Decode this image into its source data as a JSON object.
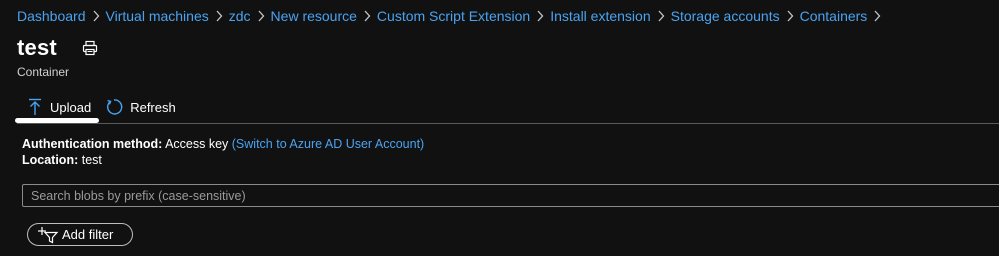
{
  "breadcrumb": {
    "items": [
      "Dashboard",
      "Virtual machines",
      "zdc",
      "New resource",
      "Custom Script Extension",
      "Install extension",
      "Storage accounts",
      "Containers"
    ]
  },
  "header": {
    "title": "test",
    "subtitle": "Container",
    "icons": [
      "print-icon"
    ]
  },
  "toolbar": {
    "upload_label": "Upload",
    "refresh_label": "Refresh",
    "icons": [
      "upload-icon",
      "refresh-icon"
    ]
  },
  "info": {
    "auth_label": "Authentication method:",
    "auth_value": "Access key",
    "auth_link": "(Switch to Azure AD User Account)",
    "location_label": "Location:",
    "location_value": "test"
  },
  "search": {
    "placeholder": "Search blobs by prefix (case-sensitive)",
    "value": ""
  },
  "filter": {
    "label": "Add filter",
    "icon": "add-filter-icon"
  },
  "colors": {
    "background": "#111111",
    "link": "#4aa3f0",
    "text": "#ffffff"
  }
}
